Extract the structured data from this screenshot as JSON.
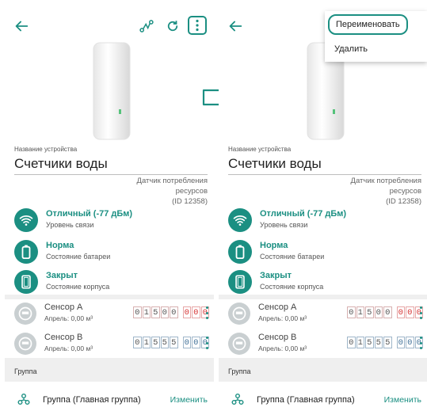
{
  "device": {
    "name_label": "Название устройства",
    "name": "Счетчики воды",
    "type_line1": "Датчик потребления",
    "type_line2": "ресурсов",
    "type_line3": "(ID 12358)"
  },
  "status": [
    {
      "title": "Отличный (-77 дБм)",
      "subtitle": "Уровень связи",
      "icon": "wifi-icon"
    },
    {
      "title": "Норма",
      "subtitle": "Состояние батареи",
      "icon": "battery-icon"
    },
    {
      "title": "Закрыт",
      "subtitle": "Состояние корпуса",
      "icon": "case-icon"
    }
  ],
  "sensors": [
    {
      "title": "Сенсор А",
      "subtitle": "Апрель: 0,00 м³",
      "integer": [
        "0",
        "1",
        "5",
        "0",
        "0"
      ],
      "fraction": [
        "0",
        "0",
        "0"
      ],
      "accent": "#d62f2f"
    },
    {
      "title": "Сенсор В",
      "subtitle": "Апрель: 0,00 м³",
      "integer": [
        "0",
        "1",
        "5",
        "5",
        "5"
      ],
      "fraction": [
        "0",
        "0",
        "0"
      ],
      "accent": "#3f6f97"
    }
  ],
  "group": {
    "header": "Группа",
    "name": "Группа (Главная группа)",
    "edit_label": "Изменить"
  },
  "menu": {
    "rename": "Переименовать",
    "delete": "Удалить"
  },
  "colors": {
    "accent": "#1b8f82",
    "divider": "#efefef"
  }
}
